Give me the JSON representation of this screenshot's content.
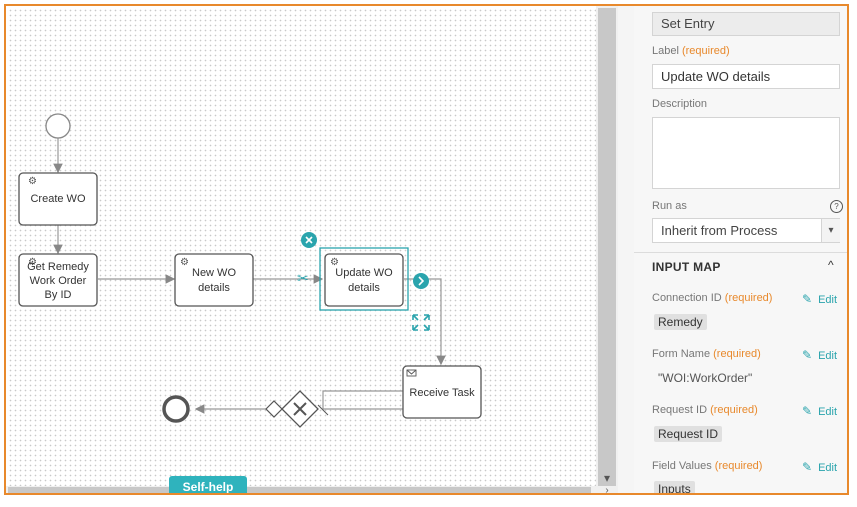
{
  "diagram": {
    "nodes": {
      "create_wo": "Create WO",
      "get_remedy": [
        "Get Remedy",
        "Work Order",
        "By ID"
      ],
      "new_wo": [
        "New WO",
        "details"
      ],
      "update_wo": [
        "Update WO",
        "details"
      ],
      "receive_task": "Receive Task"
    }
  },
  "self_help_label": "Self-help",
  "panel": {
    "type_value": "Set Entry",
    "label_label": "Label",
    "required_text": "(required)",
    "label_value": "Update WO details",
    "description_label": "Description",
    "run_as_label": "Run as",
    "run_as_value": "Inherit from Process",
    "input_map_title": "INPUT MAP",
    "edit_label": "Edit",
    "connection_id_label": "Connection ID",
    "connection_id_value": "Remedy",
    "form_name_label": "Form Name",
    "form_name_value": "\"WOI:WorkOrder\"",
    "request_id_label": "Request ID",
    "request_id_value": "Request ID",
    "field_values_label": "Field Values",
    "field_values_value": "Inputs"
  },
  "colors": {
    "accent": "#e8892c",
    "teal": "#2aa4ad"
  }
}
